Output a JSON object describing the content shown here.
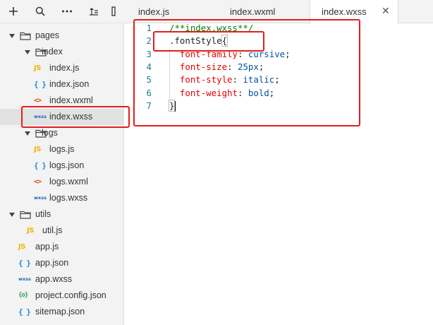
{
  "sidebar": {
    "toolbar": [
      {
        "name": "add-icon"
      },
      {
        "name": "search-icon"
      },
      {
        "name": "more-icon"
      },
      {
        "name": "sort-icon"
      },
      {
        "name": "collapse-icon"
      }
    ],
    "tree": [
      {
        "label": "pages",
        "type": "folder",
        "depth": 0,
        "expanded": true
      },
      {
        "label": "index",
        "type": "folder",
        "depth": 1,
        "expanded": true
      },
      {
        "label": "index.js",
        "type": "js",
        "depth": 2,
        "badge": "JS"
      },
      {
        "label": "index.json",
        "type": "json",
        "depth": 2,
        "badge": "{ }"
      },
      {
        "label": "index.wxml",
        "type": "wxml",
        "depth": 2,
        "badge": "<>"
      },
      {
        "label": "index.wxss",
        "type": "wxss",
        "depth": 2,
        "badge": "wxss",
        "selected": true
      },
      {
        "label": "logs",
        "type": "folder",
        "depth": 1,
        "expanded": true
      },
      {
        "label": "logs.js",
        "type": "js",
        "depth": 2,
        "badge": "JS"
      },
      {
        "label": "logs.json",
        "type": "json",
        "depth": 2,
        "badge": "{ }"
      },
      {
        "label": "logs.wxml",
        "type": "wxml",
        "depth": 2,
        "badge": "<>"
      },
      {
        "label": "logs.wxss",
        "type": "wxss",
        "depth": 2,
        "badge": "wxss"
      },
      {
        "label": "utils",
        "type": "folder",
        "depth": 0,
        "expanded": true
      },
      {
        "label": "util.js",
        "type": "js",
        "depth": 1,
        "badge": "JS"
      },
      {
        "label": "app.js",
        "type": "js",
        "depth": 0,
        "badge": "JS"
      },
      {
        "label": "app.json",
        "type": "json",
        "depth": 0,
        "badge": "{ }"
      },
      {
        "label": "app.wxss",
        "type": "wxss",
        "depth": 0,
        "badge": "wxss"
      },
      {
        "label": "project.config.json",
        "type": "config",
        "depth": 0,
        "badge": "{o}"
      },
      {
        "label": "sitemap.json",
        "type": "json",
        "depth": 0,
        "badge": "{ }"
      }
    ]
  },
  "tabs": [
    {
      "label": "index.js",
      "active": false
    },
    {
      "label": "index.wxml",
      "active": false
    },
    {
      "label": "index.wxss",
      "active": true,
      "close": "✕"
    }
  ],
  "editor": {
    "lines": [
      {
        "num": "1",
        "tokens": [
          {
            "t": "/**index.wxss**/",
            "c": "c-comment"
          }
        ]
      },
      {
        "num": "2",
        "tokens": [
          {
            "t": ".fontStyle",
            "c": "c-sel"
          },
          {
            "t": "{",
            "c": "c-punc brace-hl"
          }
        ]
      },
      {
        "num": "3",
        "tokens": [
          {
            "t": "  font-family",
            "c": "c-prop"
          },
          {
            "t": ": ",
            "c": "c-punc"
          },
          {
            "t": "cursive",
            "c": "c-val"
          },
          {
            "t": ";",
            "c": "c-punc"
          }
        ]
      },
      {
        "num": "4",
        "tokens": [
          {
            "t": "  font-size",
            "c": "c-prop"
          },
          {
            "t": ": ",
            "c": "c-punc"
          },
          {
            "t": "25px",
            "c": "c-val"
          },
          {
            "t": ";",
            "c": "c-punc"
          }
        ]
      },
      {
        "num": "5",
        "tokens": [
          {
            "t": "  font-style",
            "c": "c-prop"
          },
          {
            "t": ": ",
            "c": "c-punc"
          },
          {
            "t": "italic",
            "c": "c-val"
          },
          {
            "t": ";",
            "c": "c-punc"
          }
        ]
      },
      {
        "num": "6",
        "tokens": [
          {
            "t": "  font-weight",
            "c": "c-prop"
          },
          {
            "t": ": ",
            "c": "c-punc"
          },
          {
            "t": "bold",
            "c": "c-val"
          },
          {
            "t": ";",
            "c": "c-punc"
          }
        ]
      },
      {
        "num": "7",
        "tokens": [
          {
            "t": "}",
            "c": "c-punc brace-hl"
          }
        ],
        "cursor": true
      }
    ]
  },
  "colors": {
    "annotation": "#e41d1d",
    "comment": "#008000",
    "property": "#e50000",
    "value": "#0451a5",
    "line_number": "#237893"
  }
}
